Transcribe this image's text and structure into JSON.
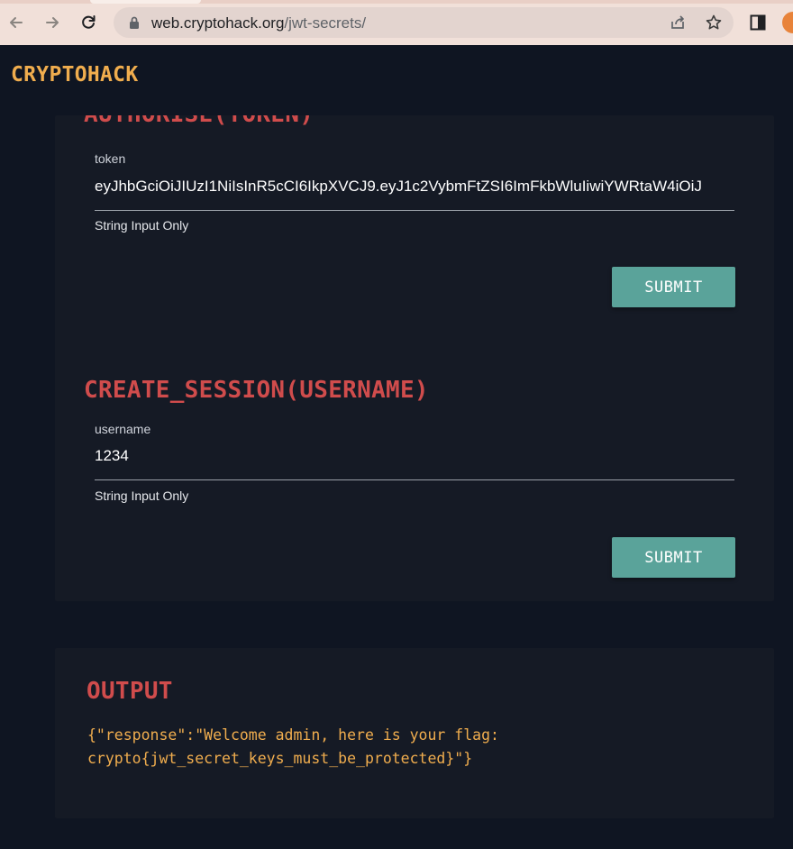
{
  "browser": {
    "url_host": "web.cryptohack.org",
    "url_path": "/jwt-secrets/"
  },
  "site": {
    "logo": "CRYPTOHACK"
  },
  "authorise": {
    "heading": "AUTHORISE(TOKEN)",
    "field_label": "token",
    "field_value": "eyJhbGciOiJIUzI1NiIsInR5cCI6IkpXVCJ9.eyJ1c2VybmFtZSI6ImFkbWluIiwiYWRtaW4iOiJ",
    "helper": "String Input Only",
    "submit_label": "SUBMIT"
  },
  "create_session": {
    "heading": "CREATE_SESSION(USERNAME)",
    "field_label": "username",
    "field_value": "1234",
    "helper": "String Input Only",
    "submit_label": "SUBMIT"
  },
  "output": {
    "heading": "OUTPUT",
    "text": "{\"response\":\"Welcome admin, here is your flag: crypto{jwt_secret_keys_must_be_protected}\"}"
  },
  "colors": {
    "accent_gold": "#f0ad4e",
    "heading_red": "#d04c4c",
    "button_teal": "#5aa39a",
    "background": "#0f1522",
    "card": "#151a25"
  }
}
